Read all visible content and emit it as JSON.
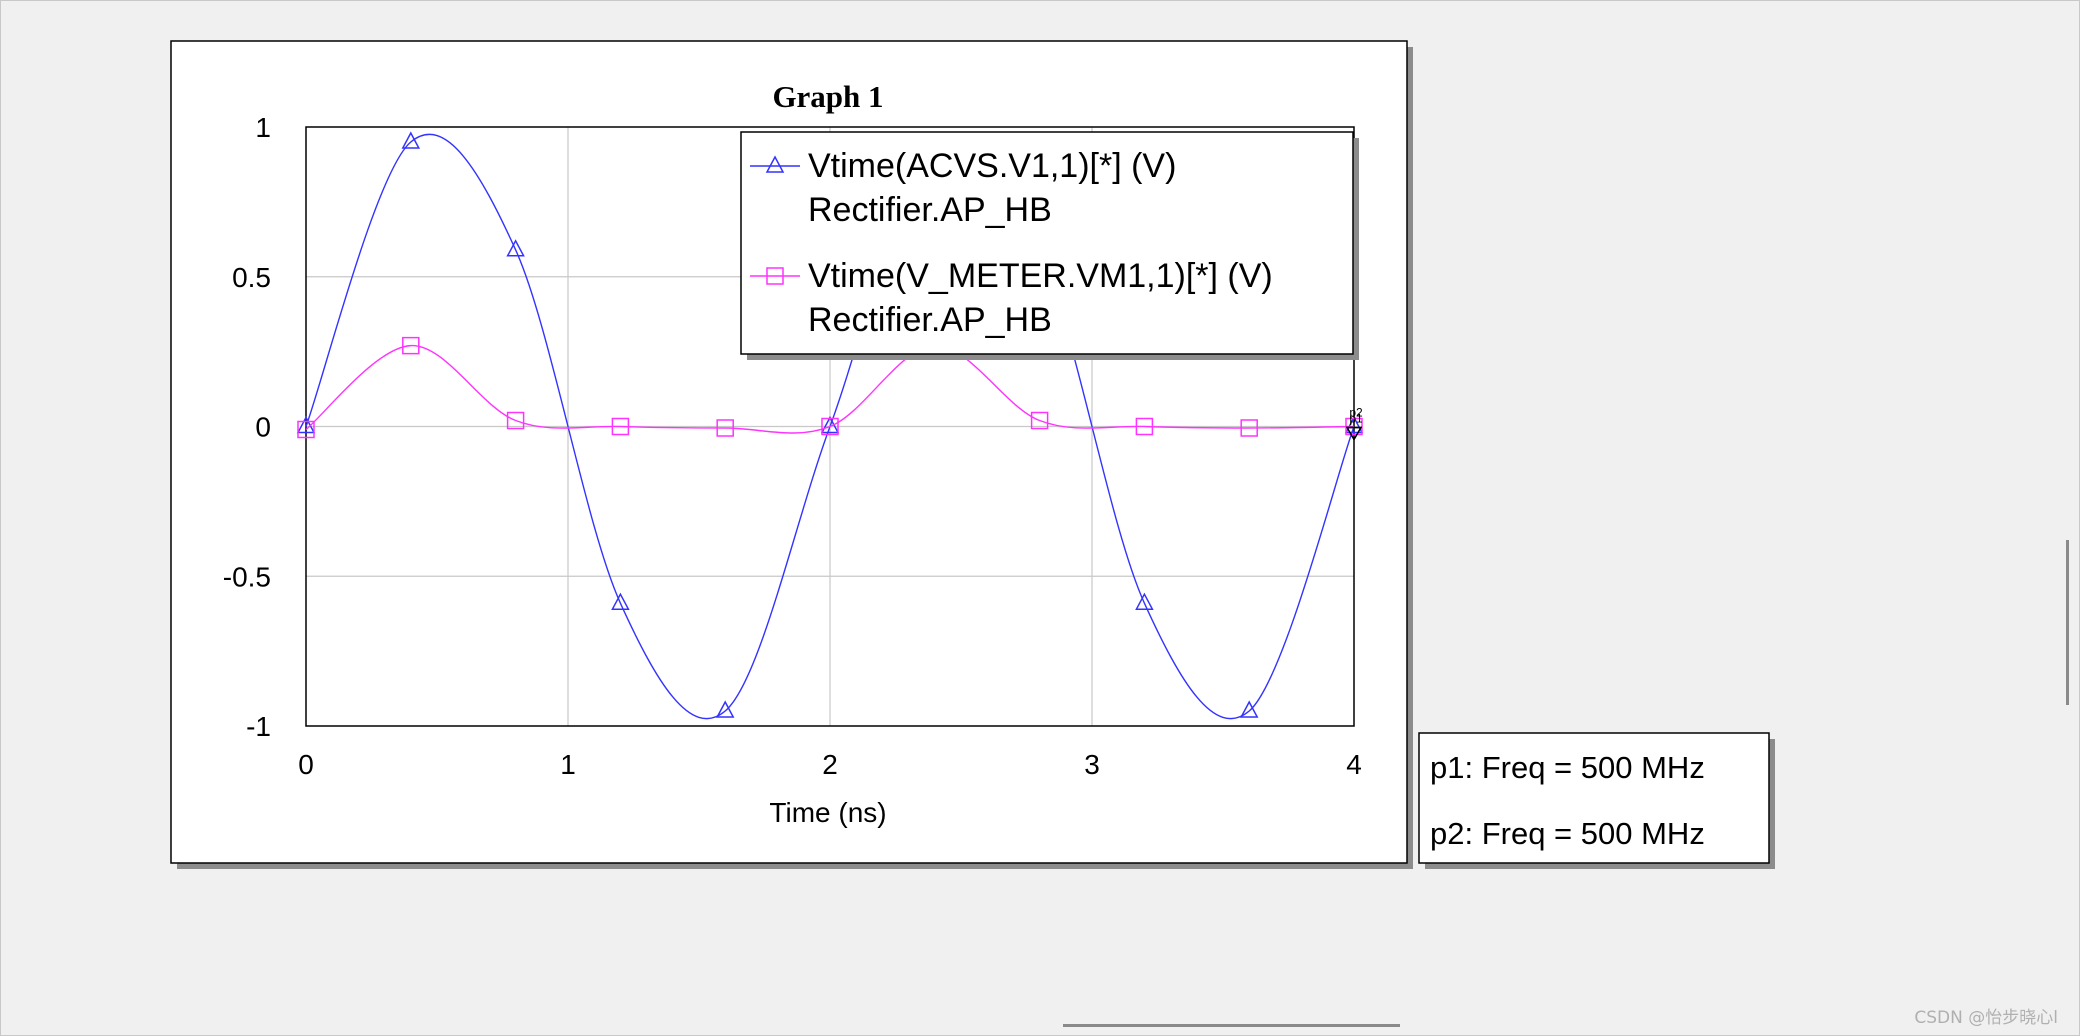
{
  "graph": {
    "title": "Graph 1"
  },
  "chart_data": {
    "type": "line",
    "title": "Graph 1",
    "xlabel": "Time (ns)",
    "ylabel": "",
    "xlim": [
      0,
      4
    ],
    "ylim": [
      -1,
      1
    ],
    "x_ticks": [
      "0",
      "1",
      "2",
      "3",
      "4"
    ],
    "y_ticks": [
      "1",
      "0.5",
      "0",
      "-0.5",
      "-1"
    ],
    "grid": true,
    "legend_position": "top-right",
    "series": [
      {
        "name_line1": "Vtime(ACVS.V1,1)[*] (V)",
        "name_line2": "Rectifier.AP_HB",
        "color": "#3333ff",
        "marker": "triangle",
        "x": [
          0.0,
          0.4,
          0.8,
          1.2,
          1.6,
          2.0,
          2.4,
          2.8,
          3.2,
          3.6,
          4.0
        ],
        "y": [
          0.0,
          0.95,
          0.59,
          -0.59,
          -0.95,
          0.0,
          0.95,
          0.59,
          -0.59,
          -0.95,
          0.0
        ]
      },
      {
        "name_line1": "Vtime(V_METER.VM1,1)[*] (V)",
        "name_line2": "Rectifier.AP_HB",
        "color": "#ff33ff",
        "marker": "square",
        "x": [
          0.0,
          0.4,
          0.8,
          1.2,
          1.6,
          2.0,
          2.4,
          2.8,
          3.2,
          3.6,
          4.0
        ],
        "y": [
          -0.01,
          0.27,
          0.02,
          0.0,
          -0.005,
          0.0,
          0.27,
          0.02,
          0.0,
          -0.005,
          0.0
        ]
      }
    ],
    "markers": [
      {
        "label": "p1",
        "x": 4.0,
        "y": 0.0
      },
      {
        "label": "p2",
        "x": 4.0,
        "y": 0.0
      }
    ]
  },
  "marker_readout": {
    "lines": [
      "p1: Freq = 500 MHz",
      "p2: Freq = 500 MHz"
    ]
  },
  "watermark": "CSDN @怡步晓心l"
}
